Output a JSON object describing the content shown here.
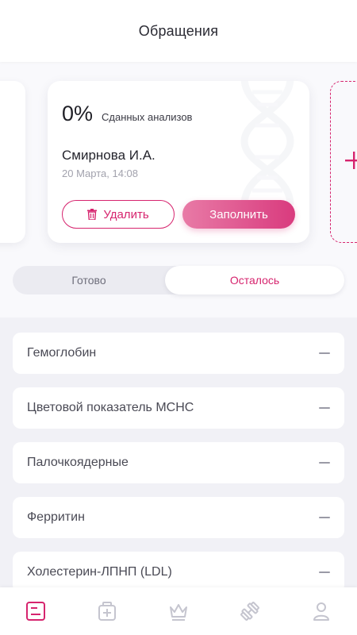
{
  "header": {
    "title": "Обращения"
  },
  "card": {
    "percent": "0%",
    "percent_label": "Сданных анализов",
    "patient_name": "Смирнова И.А.",
    "date": "20 Марта, 14:08",
    "delete_label": "Удалить",
    "fill_label": "Заполнить"
  },
  "segments": {
    "ready": "Готово",
    "remaining": "Осталось",
    "selected": "remaining"
  },
  "analyses": [
    {
      "label": "Гемоглобин"
    },
    {
      "label": "Цветовой показатель MCHC"
    },
    {
      "label": "Палочкоядерные"
    },
    {
      "label": "Ферритин"
    },
    {
      "label": "Холестерин-ЛПНП (LDL)"
    }
  ],
  "tabbar": {
    "items": [
      "document-icon",
      "medical-case-icon",
      "crown-icon",
      "dumbbell-icon",
      "profile-icon"
    ],
    "active": "document-icon"
  },
  "colors": {
    "accent": "#d6246e",
    "accent_light": "#e87aa6",
    "muted_icon": "#c5c5cf"
  }
}
